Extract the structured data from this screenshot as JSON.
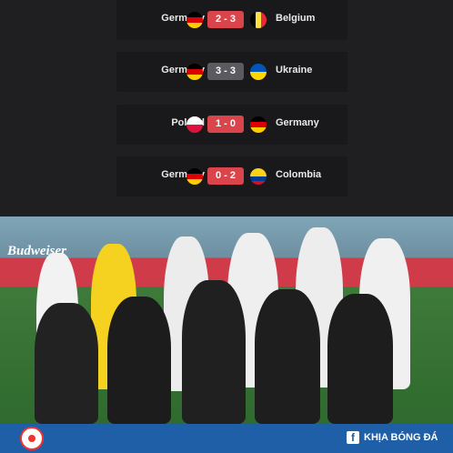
{
  "results": [
    {
      "home": "Germany",
      "away": "Belgium",
      "score": "2 - 3",
      "outcome": "loss",
      "home_flag": "germany-flag",
      "away_flag": "belgium-flag"
    },
    {
      "home": "Germany",
      "away": "Ukraine",
      "score": "3 - 3",
      "outcome": "draw",
      "home_flag": "germany-flag",
      "away_flag": "ukraine-flag"
    },
    {
      "home": "Poland",
      "away": "Germany",
      "score": "1 - 0",
      "outcome": "loss",
      "home_flag": "poland-flag",
      "away_flag": "germany-flag"
    },
    {
      "home": "Germany",
      "away": "Colombia",
      "score": "0 - 2",
      "outcome": "loss",
      "home_flag": "germany-flag",
      "away_flag": "colombia-flag"
    }
  ],
  "photo": {
    "ad_banner": "Budweiser"
  },
  "footer": {
    "brand": "KHỊA BÓNG ĐÁ",
    "social_icon": "facebook-icon",
    "logo": "club-logo"
  },
  "colors": {
    "loss": "#d9454a",
    "draw": "#5a5a60",
    "footer": "#1e5fa8"
  }
}
